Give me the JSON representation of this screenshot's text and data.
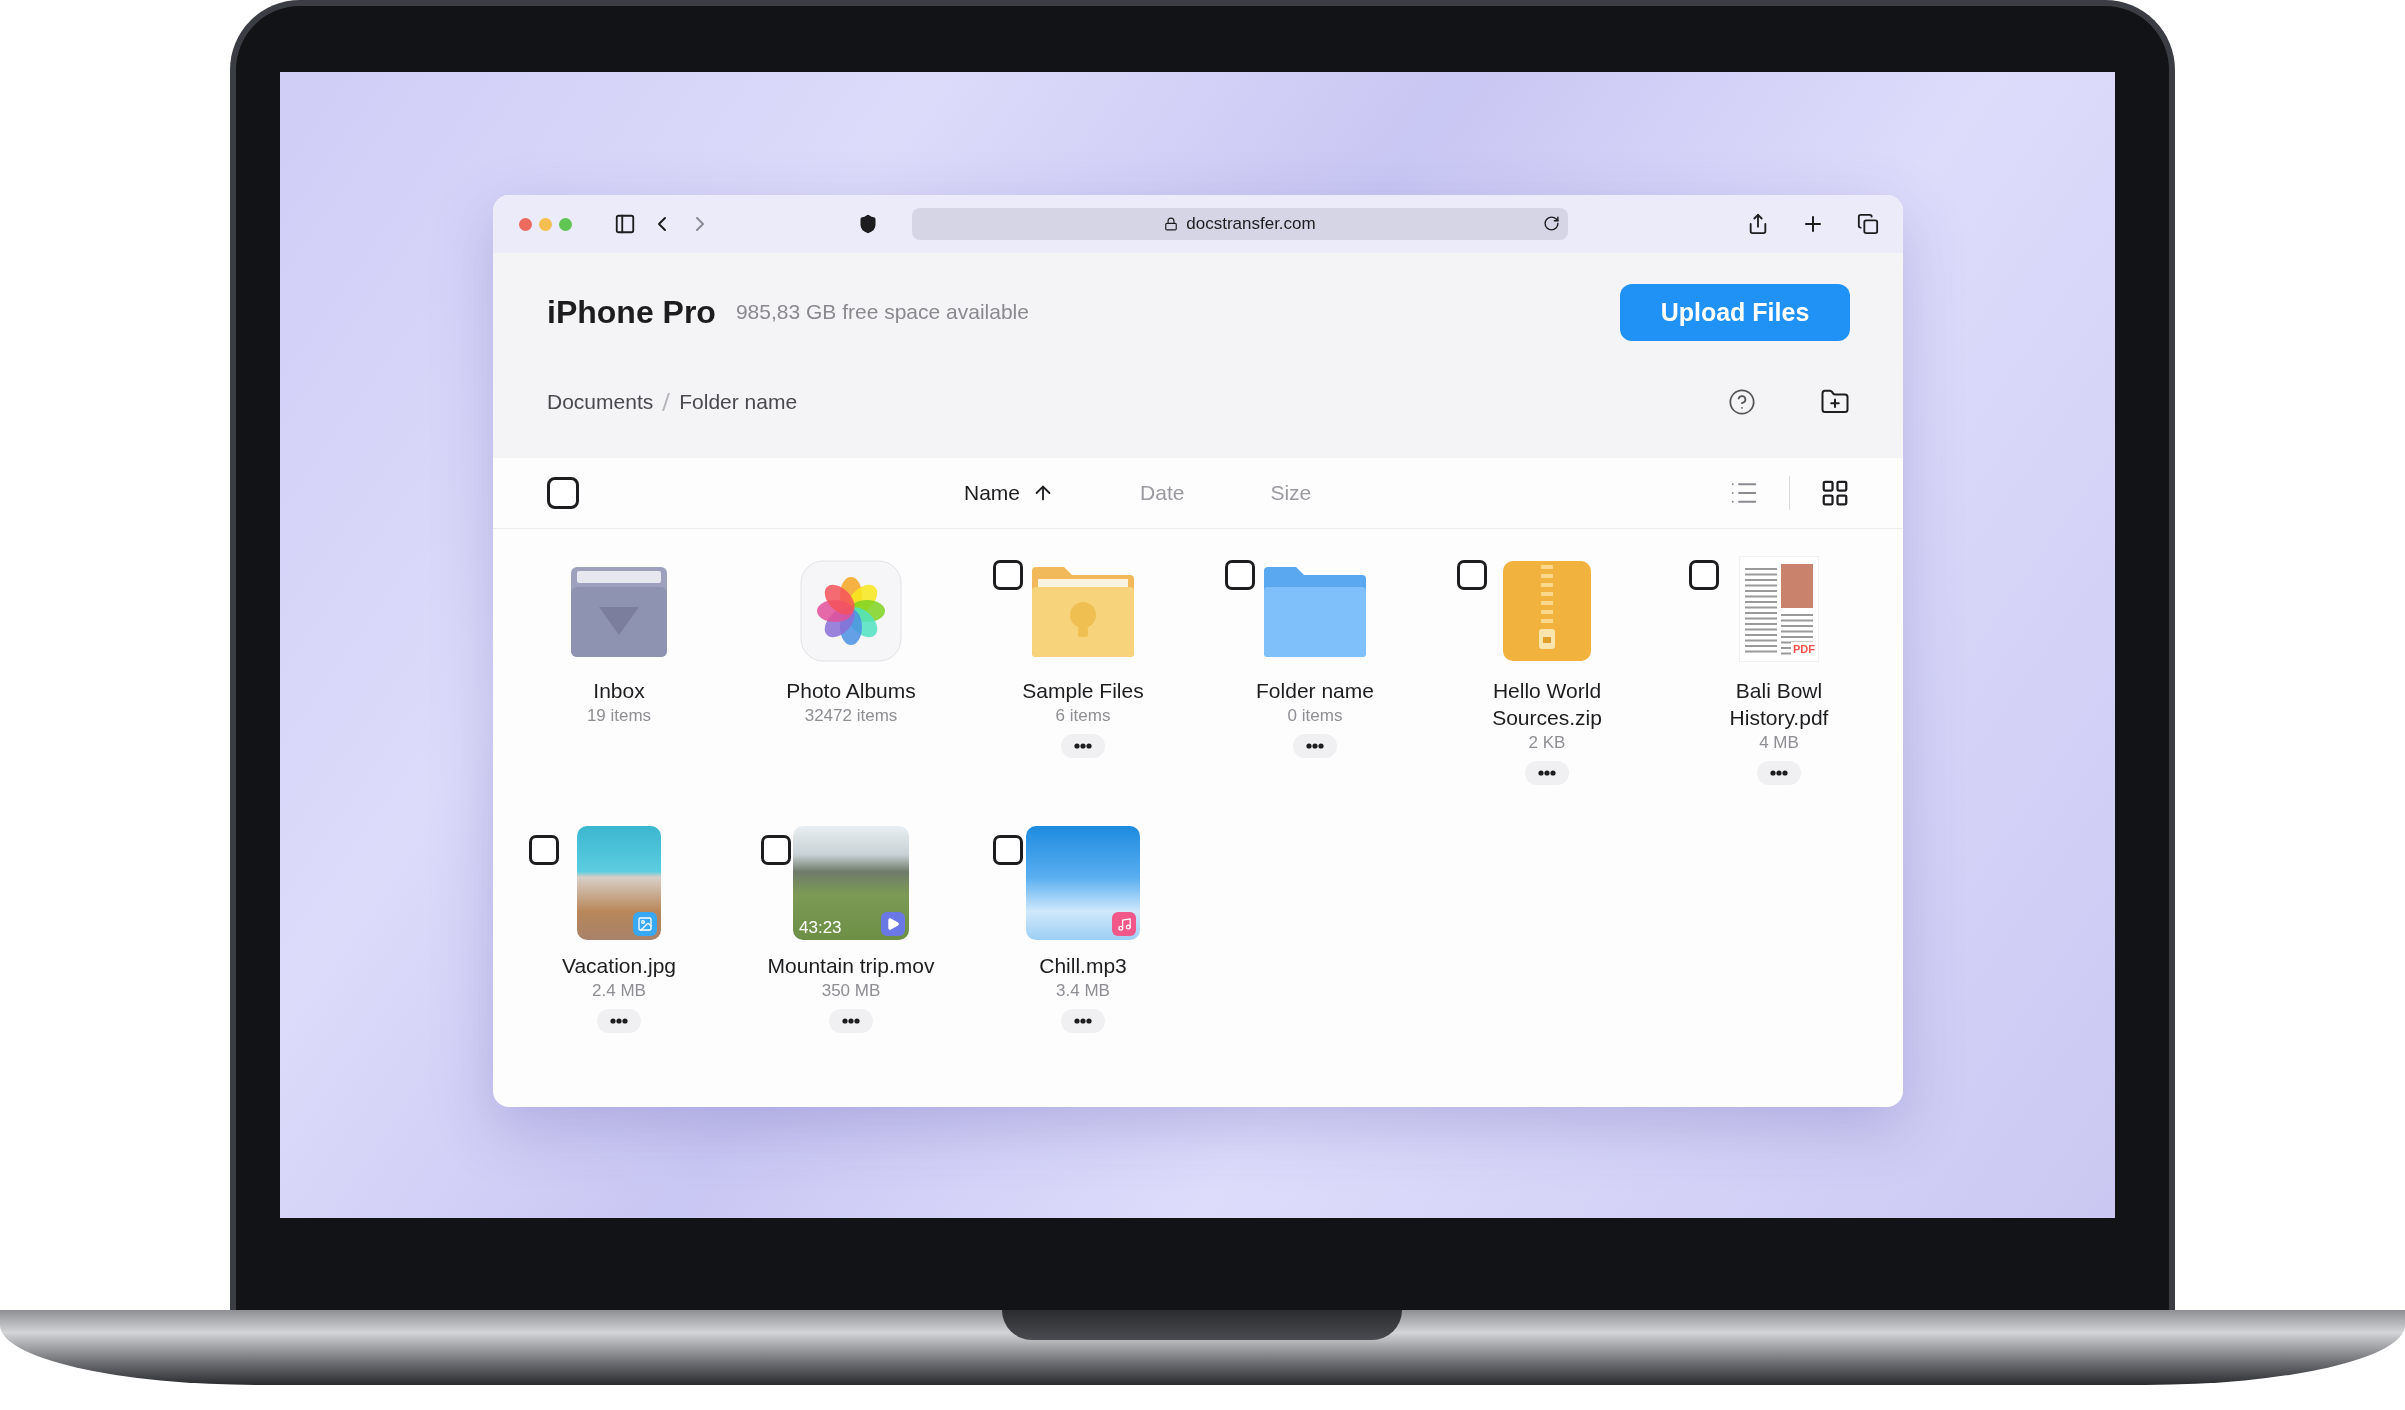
{
  "browser": {
    "traffic_lights": [
      {
        "color": "#ed6a5e"
      },
      {
        "color": "#f5bf4f"
      },
      {
        "color": "#61c554"
      }
    ],
    "back_enabled": true,
    "forward_enabled": false,
    "url": "docstransfer.com"
  },
  "header": {
    "device": "iPhone Pro",
    "free_space": "985,83 GB free space available",
    "upload_button": "Upload Files"
  },
  "breadcrumbs": [
    {
      "label": "Documents"
    },
    {
      "label": "Folder name"
    }
  ],
  "select_all": {
    "checked": false
  },
  "sort_columns": [
    {
      "label": "Name",
      "selected": true
    },
    {
      "label": "Date",
      "selected": false
    },
    {
      "label": "Size",
      "selected": false
    }
  ],
  "views": [
    {
      "kind": "list",
      "selected": false
    },
    {
      "kind": "grid",
      "selected": true
    }
  ],
  "items": [
    {
      "kind": "inbox",
      "name": "Inbox",
      "detail": "19 items",
      "system": true
    },
    {
      "kind": "photos",
      "name": "Photo Albums",
      "detail": "32472 items",
      "system": true
    },
    {
      "kind": "idea-folder",
      "name": "Sample Files",
      "detail": "6 items",
      "system": false,
      "checked": false
    },
    {
      "kind": "folder",
      "name": "Folder name",
      "detail": "0 items",
      "system": false,
      "checked": false
    },
    {
      "kind": "zip",
      "name": "Hello World Sources.zip",
      "detail": "2 KB",
      "system": false,
      "checked": false
    },
    {
      "kind": "pdf",
      "name": "Bali Bowl History.pdf",
      "detail": "4 MB",
      "badge": "PDF",
      "system": false,
      "checked": false
    },
    {
      "kind": "image",
      "name": "Vacation.jpg",
      "detail": "2.4 MB",
      "system": false,
      "checked": false
    },
    {
      "kind": "video",
      "name": "Mountain trip.mov",
      "detail": "350 MB",
      "duration": "43:23",
      "system": false,
      "checked": false
    },
    {
      "kind": "audio",
      "name": "Chill.mp3",
      "detail": "3.4 MB",
      "system": false,
      "checked": false
    }
  ]
}
